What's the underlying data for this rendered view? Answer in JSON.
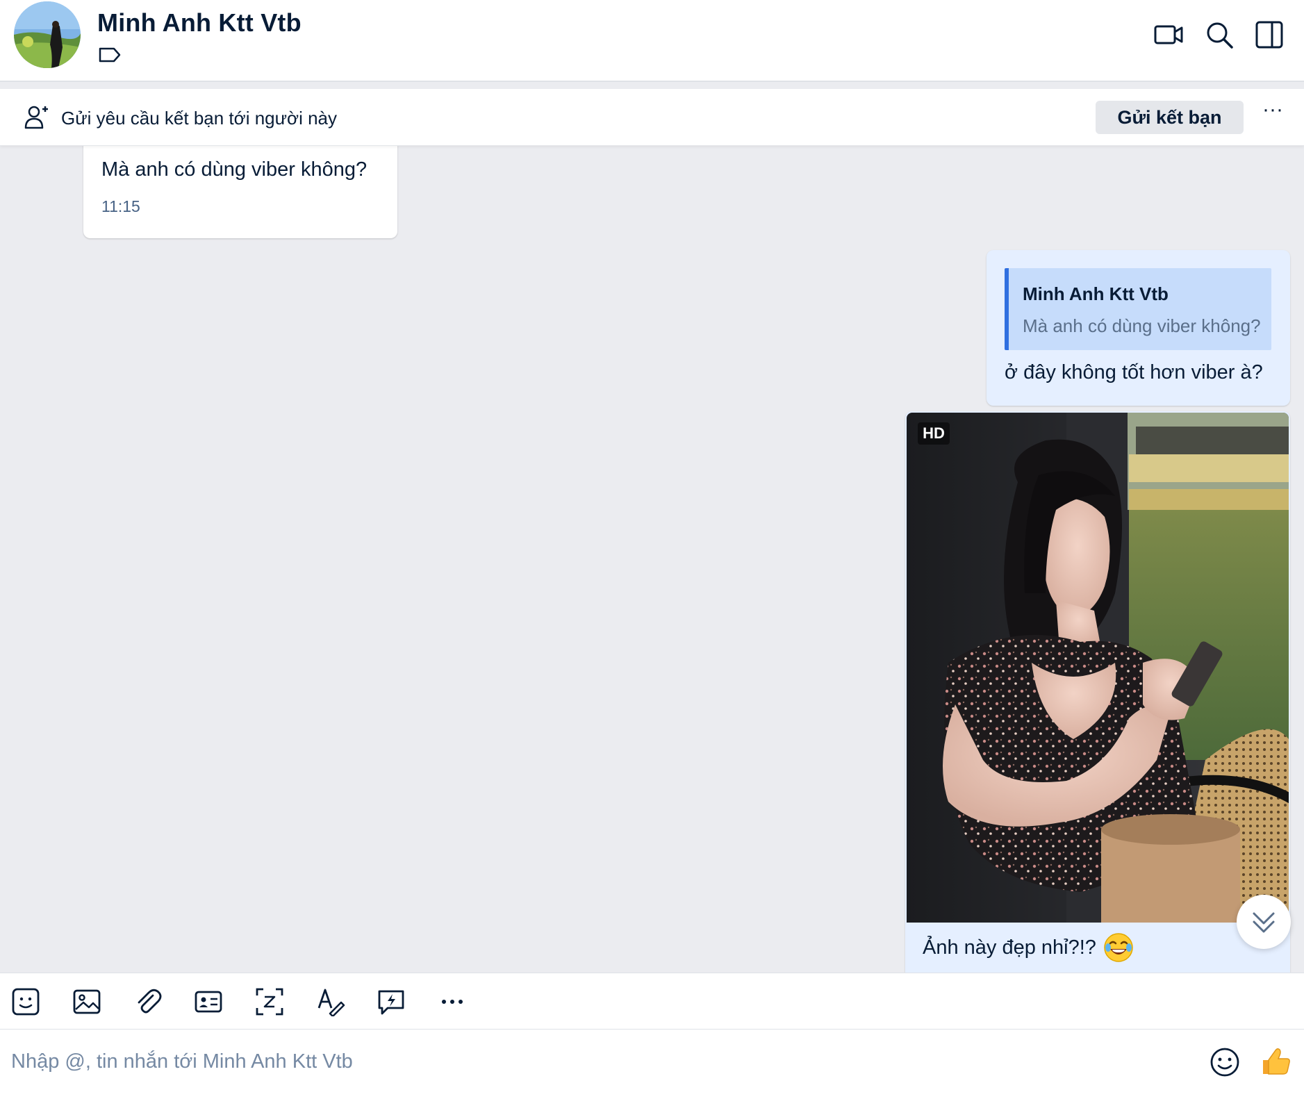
{
  "header": {
    "title": "Minh Anh Ktt Vtb",
    "icons": [
      "video-call-icon",
      "search-icon",
      "sidebar-toggle-icon"
    ]
  },
  "friend_request": {
    "text": "Gửi yêu cầu kết bạn tới người này",
    "button_label": "Gửi kết bạn",
    "more_label": "···"
  },
  "messages": [
    {
      "direction": "incoming",
      "text": "Mà anh có dùng viber không?",
      "time": "11:15"
    },
    {
      "direction": "outgoing",
      "quote": {
        "name": "Minh Anh Ktt Vtb",
        "text": "Mà anh có dùng viber không?"
      },
      "text": "ở đây không tốt hơn viber à?"
    },
    {
      "direction": "outgoing",
      "type": "image",
      "badge": "HD",
      "caption": "Ảnh này đẹp nhỉ?!?",
      "emoji": "laugh-icon"
    }
  ],
  "toolbar": {
    "tools": [
      "sticker-icon",
      "image-icon",
      "attachment-icon",
      "contact-card-icon",
      "screenshot-icon",
      "text-format-icon",
      "quick-message-icon",
      "more-icon"
    ]
  },
  "composer": {
    "placeholder": "Nhập @, tin nhắn tới Minh Anh Ktt Vtb",
    "value": ""
  },
  "colors": {
    "accent": "#2f6fe0",
    "outgoing_bubble": "#e5efff",
    "quote_bg": "#c6dcfb",
    "chat_bg": "#ebecf0",
    "text": "#081c36"
  }
}
